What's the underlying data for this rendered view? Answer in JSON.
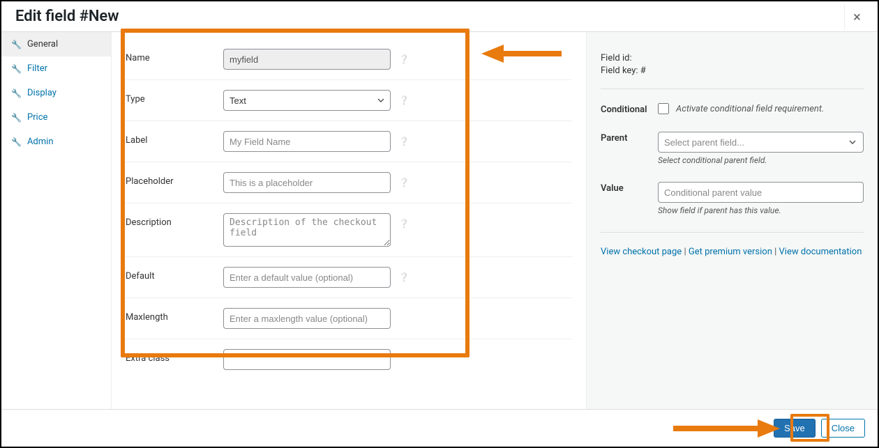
{
  "header": {
    "title": "Edit field #New"
  },
  "sidebar": {
    "items": [
      {
        "label": "General"
      },
      {
        "label": "Filter"
      },
      {
        "label": "Display"
      },
      {
        "label": "Price"
      },
      {
        "label": "Admin"
      }
    ]
  },
  "form": {
    "name_label": "Name",
    "name_value": "myfield",
    "type_label": "Type",
    "type_value": "Text",
    "label_label": "Label",
    "label_placeholder": "My Field Name",
    "placeholder_label": "Placeholder",
    "placeholder_placeholder": "This is a placeholder",
    "description_label": "Description",
    "description_placeholder": "Description of the checkout field",
    "default_label": "Default",
    "default_placeholder": "Enter a default value (optional)",
    "maxlength_label": "Maxlength",
    "maxlength_placeholder": "Enter a maxlength value (optional)",
    "extraclass_label": "Extra class"
  },
  "right": {
    "field_id_label": "Field id:",
    "field_key_label": "Field key: #",
    "conditional_label": "Conditional",
    "conditional_text": "Activate conditional field requirement.",
    "parent_label": "Parent",
    "parent_placeholder": "Select parent field...",
    "parent_helper": "Select conditional parent field.",
    "value_label": "Value",
    "value_placeholder": "Conditional parent value",
    "value_helper": "Show field if parent has this value.",
    "links": {
      "checkout": "View checkout page",
      "premium": "Get premium version",
      "docs": "View documentation",
      "sep": " | "
    }
  },
  "footer": {
    "save": "Save",
    "close": "Close"
  }
}
